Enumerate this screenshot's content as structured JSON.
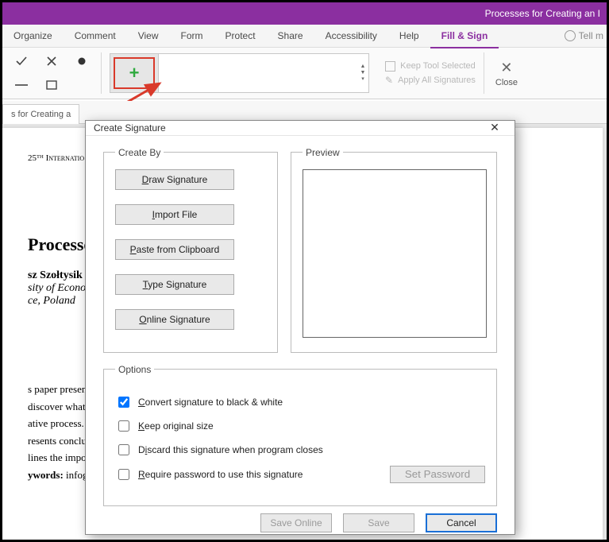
{
  "titlebar": {
    "title": "Processes for Creating an I"
  },
  "menu": {
    "items": [
      "Organize",
      "Comment",
      "View",
      "Form",
      "Protect",
      "Share",
      "Accessibility",
      "Help",
      "Fill & Sign"
    ],
    "active_index": 8,
    "tell_me": "Tell m"
  },
  "ribbon": {
    "keep_tool": "Keep Tool Selected",
    "apply_all": "Apply All Signatures",
    "close": "Close"
  },
  "tab": {
    "label": "s for Creating a"
  },
  "document": {
    "header": "25ᵀᴴ Internatio",
    "title": "Processe",
    "author": "sz Szołtysik",
    "affil1": "sity of Econo",
    "affil2": "ce, Poland",
    "body1": "s paper presen",
    "body2": "discover what",
    "body3": "ative process.",
    "body4": "resents conclu",
    "body5": "lines the impo",
    "body6_label": "ywords:",
    "body6_rest": " infog"
  },
  "dialog": {
    "title": "Create Signature",
    "createby_legend": "Create By",
    "preview_legend": "Preview",
    "options_legend": "Options",
    "btn_draw": "Draw Signature",
    "btn_import": "Import File",
    "btn_paste": "Paste from Clipboard",
    "btn_type": "Type Signature",
    "btn_online": "Online Signature",
    "opt_convert": "Convert signature to black & white",
    "opt_keep": "Keep original size",
    "opt_discard": "Discard this signature when program closes",
    "opt_require": "Require password to use this signature",
    "set_password": "Set Password",
    "save_online": "Save Online",
    "save": "Save",
    "cancel": "Cancel",
    "convert_checked": true
  }
}
